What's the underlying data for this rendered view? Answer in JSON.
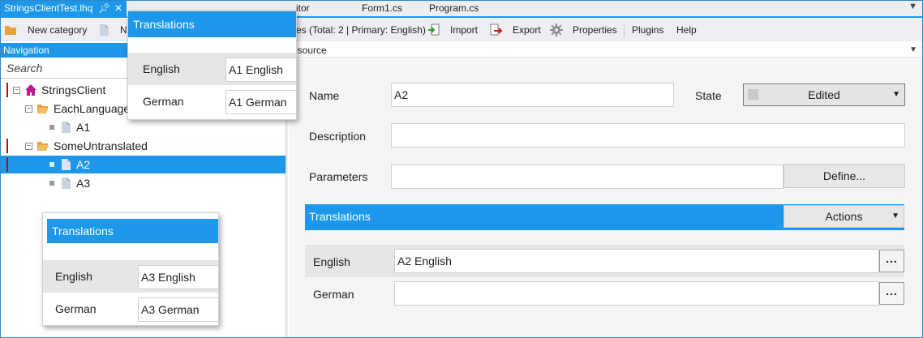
{
  "tabs": [
    {
      "label": "StringsClientTest.lhq",
      "active": true
    },
    {
      "label": "itor"
    },
    {
      "label": "Form1.cs"
    },
    {
      "label": "Program.cs"
    }
  ],
  "toolbar": {
    "new_category": "New category",
    "new_resource_fragment": "N",
    "languages_info": "es (Total: 2 | Primary: English)",
    "import": "Import",
    "export": "Export",
    "properties": "Properties",
    "plugins": "Plugins",
    "help": "Help"
  },
  "navigation": {
    "header": "Navigation",
    "search_placeholder": "Search",
    "tree": [
      {
        "label": "StringsClient"
      },
      {
        "label": "EachLanguage"
      },
      {
        "label": "A1"
      },
      {
        "label": "SomeUntranslated"
      },
      {
        "label": "A2",
        "selected": true
      },
      {
        "label": "A3"
      }
    ]
  },
  "resource_header": "esource",
  "editor": {
    "name_label": "Name",
    "name_value": "A2",
    "state_label": "State",
    "state_value": "Edited",
    "description_label": "Description",
    "description_value": "",
    "parameters_label": "Parameters",
    "parameters_value": "",
    "define_button": "Define...",
    "translations_title": "Translations",
    "actions_button": "Actions",
    "translations": [
      {
        "language": "English",
        "value": "A2 English"
      },
      {
        "language": "German",
        "value": ""
      }
    ],
    "ellipsis": "..."
  },
  "popups": [
    {
      "title": "Translations",
      "rows": [
        {
          "language": "English",
          "value": "A1 English"
        },
        {
          "language": "German",
          "value": "A1 German"
        }
      ]
    },
    {
      "title": "Translations",
      "rows": [
        {
          "language": "English",
          "value": "A3 English"
        },
        {
          "language": "German",
          "value": "A3 German"
        }
      ]
    }
  ],
  "icons": {
    "folder": "folder-icon",
    "file": "file-icon",
    "home": "home-icon",
    "import": "import-icon",
    "export": "export-icon",
    "gear": "gear-icon"
  },
  "colors": {
    "accent": "#1c97ea",
    "marker": "#d10000",
    "folder": "#e8a33d",
    "home": "#c0198c"
  }
}
